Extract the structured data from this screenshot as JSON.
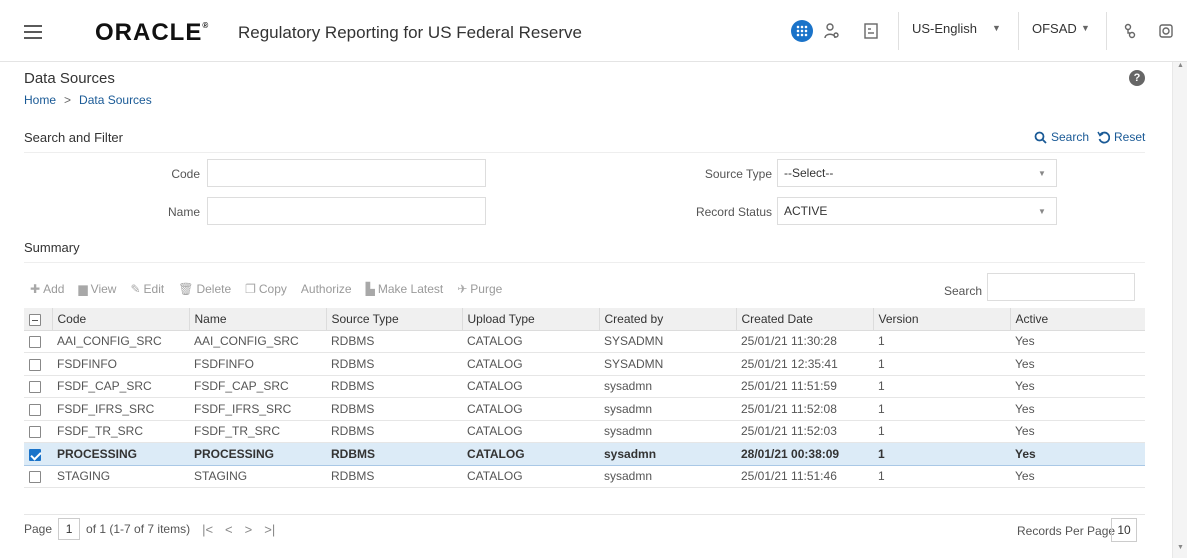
{
  "header": {
    "logo_text": "ORACLE",
    "app_title": "Regulatory Reporting for US Federal Reserve",
    "language": "US-English",
    "user": "OFSAD",
    "accent_color": "#1a73c9"
  },
  "page": {
    "title": "Data Sources",
    "help": "?",
    "breadcrumb": {
      "home": "Home",
      "separator": ">",
      "current": "Data Sources"
    }
  },
  "search_filter": {
    "title": "Search and Filter",
    "search_label": "Search",
    "reset_label": "Reset",
    "code_label": "Code",
    "code_value": "",
    "name_label": "Name",
    "name_value": "",
    "source_type_label": "Source Type",
    "source_type_value": "--Select--",
    "record_status_label": "Record Status",
    "record_status_value": "ACTIVE"
  },
  "summary": {
    "title": "Summary",
    "toolbar": {
      "add": "Add",
      "view": "View",
      "edit": "Edit",
      "delete": "Delete",
      "copy": "Copy",
      "authorize": "Authorize",
      "make_latest": "Make Latest",
      "purge": "Purge"
    },
    "search_label": "Search",
    "columns": [
      "Code",
      "Name",
      "Source Type",
      "Upload Type",
      "Created by",
      "Created Date",
      "Version",
      "Active"
    ],
    "rows": [
      {
        "code": "AAI_CONFIG_SRC",
        "name": "AAI_CONFIG_SRC",
        "source_type": "RDBMS",
        "upload_type": "CATALOG",
        "created_by": "SYSADMN",
        "created_date": "25/01/21 11:30:28",
        "version": "1",
        "active": "Yes",
        "selected": false
      },
      {
        "code": "FSDFINFO",
        "name": "FSDFINFO",
        "source_type": "RDBMS",
        "upload_type": "CATALOG",
        "created_by": "SYSADMN",
        "created_date": "25/01/21 12:35:41",
        "version": "1",
        "active": "Yes",
        "selected": false
      },
      {
        "code": "FSDF_CAP_SRC",
        "name": "FSDF_CAP_SRC",
        "source_type": "RDBMS",
        "upload_type": "CATALOG",
        "created_by": "sysadmn",
        "created_date": "25/01/21 11:51:59",
        "version": "1",
        "active": "Yes",
        "selected": false
      },
      {
        "code": "FSDF_IFRS_SRC",
        "name": "FSDF_IFRS_SRC",
        "source_type": "RDBMS",
        "upload_type": "CATALOG",
        "created_by": "sysadmn",
        "created_date": "25/01/21 11:52:08",
        "version": "1",
        "active": "Yes",
        "selected": false
      },
      {
        "code": "FSDF_TR_SRC",
        "name": "FSDF_TR_SRC",
        "source_type": "RDBMS",
        "upload_type": "CATALOG",
        "created_by": "sysadmn",
        "created_date": "25/01/21 11:52:03",
        "version": "1",
        "active": "Yes",
        "selected": false
      },
      {
        "code": "PROCESSING",
        "name": "PROCESSING",
        "source_type": "RDBMS",
        "upload_type": "CATALOG",
        "created_by": "sysadmn",
        "created_date": "28/01/21 00:38:09",
        "version": "1",
        "active": "Yes",
        "selected": true
      },
      {
        "code": "STAGING",
        "name": "STAGING",
        "source_type": "RDBMS",
        "upload_type": "CATALOG",
        "created_by": "sysadmn",
        "created_date": "25/01/21 11:51:46",
        "version": "1",
        "active": "Yes",
        "selected": false
      }
    ]
  },
  "pager": {
    "page_label": "Page",
    "page_value": "1",
    "summary": "of 1 (1-7 of 7 items)",
    "records_per_page_label": "Records Per Page",
    "records_per_page_value": "10"
  }
}
